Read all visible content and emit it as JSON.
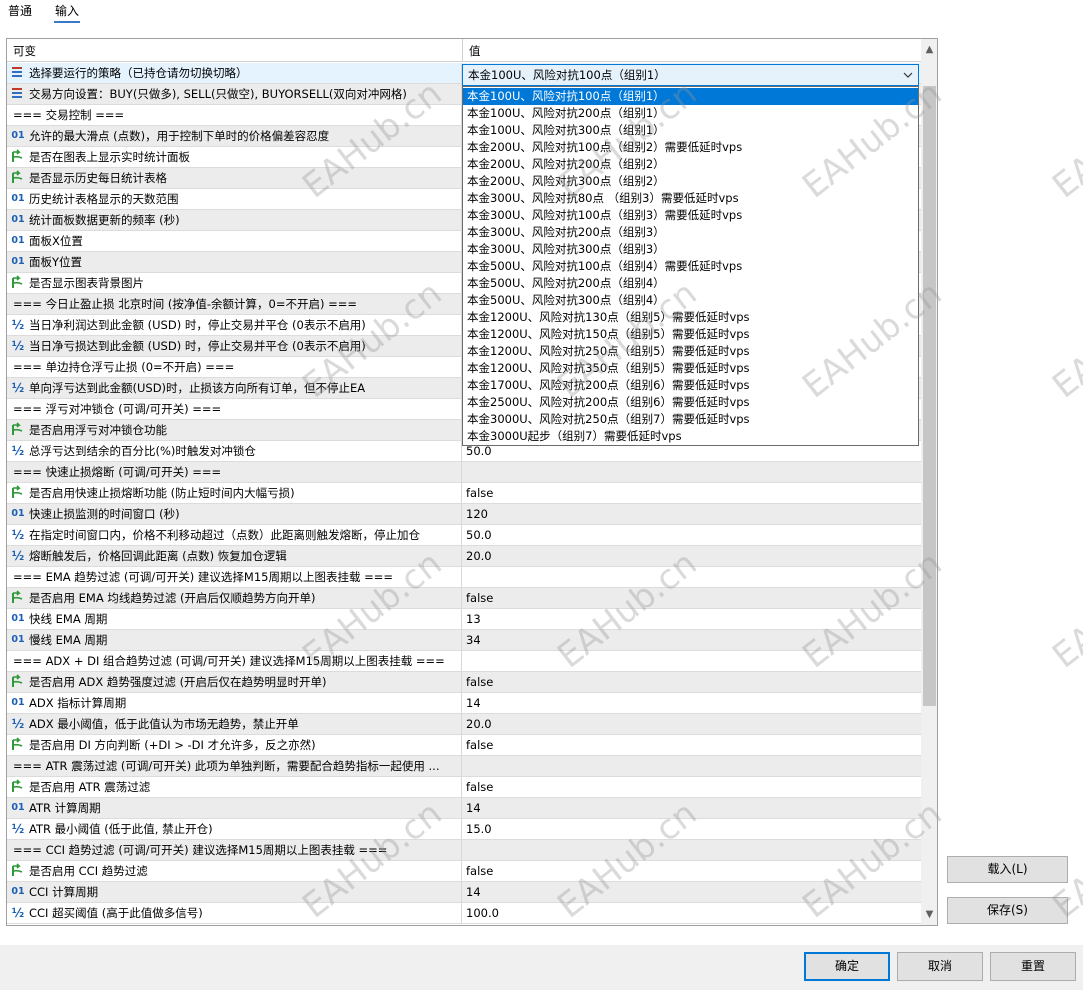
{
  "tabs": [
    "普通",
    "输入"
  ],
  "table": {
    "col_name": "可变",
    "col_value": "值"
  },
  "rows": [
    {
      "icon": "enum",
      "name": "选择要运行的策略（已持仓请勿切换切略）",
      "value": "本金100U、风险对抗100点（组别1）"
    },
    {
      "icon": "enum",
      "name": "交易方向设置：BUY(只做多), SELL(只做空), BUYORSELL(双向对冲网格)",
      "value": ""
    },
    {
      "icon": "",
      "name": "=== 交易控制 ===",
      "value": ""
    },
    {
      "icon": "int",
      "name": "允许的最大滑点 (点数)，用于控制下单时的价格偏差容忍度",
      "value": ""
    },
    {
      "icon": "bool",
      "name": "是否在图表上显示实时统计面板",
      "value": ""
    },
    {
      "icon": "bool",
      "name": "是否显示历史每日统计表格",
      "value": ""
    },
    {
      "icon": "int",
      "name": "历史统计表格显示的天数范围",
      "value": ""
    },
    {
      "icon": "int",
      "name": "统计面板数据更新的频率 (秒)",
      "value": ""
    },
    {
      "icon": "int",
      "name": "面板X位置",
      "value": ""
    },
    {
      "icon": "int",
      "name": "面板Y位置",
      "value": ""
    },
    {
      "icon": "bool",
      "name": "是否显示图表背景图片",
      "value": ""
    },
    {
      "icon": "",
      "name": "=== 今日止盈止损 北京时间 (按净值-余额计算，0=不开启) ===",
      "value": ""
    },
    {
      "icon": "dbl",
      "name": "当日净利润达到此金额 (USD) 时，停止交易并平仓 (0表示不启用)",
      "value": ""
    },
    {
      "icon": "dbl",
      "name": "当日净亏损达到此金额 (USD) 时，停止交易并平仓 (0表示不启用)",
      "value": ""
    },
    {
      "icon": "",
      "name": "=== 单边持仓浮亏止损 (0=不开启) ===",
      "value": ""
    },
    {
      "icon": "dbl",
      "name": "单向浮亏达到此金额(USD)时，止损该方向所有订单，但不停止EA",
      "value": ""
    },
    {
      "icon": "",
      "name": "=== 浮亏对冲锁仓 (可调/可开关)  ===",
      "value": ""
    },
    {
      "icon": "bool",
      "name": "是否启用浮亏对冲锁仓功能",
      "value": ""
    },
    {
      "icon": "dbl",
      "name": "总浮亏达到结余的百分比(%)时触发对冲锁仓",
      "value": "50.0"
    },
    {
      "icon": "",
      "name": "=== 快速止损熔断 (可调/可开关)  ===",
      "value": ""
    },
    {
      "icon": "bool",
      "name": "是否启用快速止损熔断功能 (防止短时间内大幅亏损)",
      "value": "false"
    },
    {
      "icon": "int",
      "name": "快速止损监测的时间窗口 (秒)",
      "value": "120"
    },
    {
      "icon": "dbl",
      "name": "在指定时间窗口内，价格不利移动超过（点数）此距离则触发熔断，停止加仓",
      "value": "50.0"
    },
    {
      "icon": "dbl",
      "name": "熔断触发后，价格回调此距离 (点数) 恢复加仓逻辑",
      "value": "20.0"
    },
    {
      "icon": "",
      "name": "=== EMA 趋势过滤 (可调/可开关) 建议选择M15周期以上图表挂载 ===",
      "value": ""
    },
    {
      "icon": "bool",
      "name": "是否启用 EMA 均线趋势过滤 (开启后仅顺趋势方向开单)",
      "value": "false"
    },
    {
      "icon": "int",
      "name": "快线 EMA 周期",
      "value": "13"
    },
    {
      "icon": "int",
      "name": "慢线 EMA 周期",
      "value": "34"
    },
    {
      "icon": "",
      "name": "=== ADX + DI 组合趋势过滤 (可调/可开关) 建议选择M15周期以上图表挂载 ===",
      "value": ""
    },
    {
      "icon": "bool",
      "name": "是否启用 ADX 趋势强度过滤 (开启后仅在趋势明显时开单)",
      "value": "false"
    },
    {
      "icon": "int",
      "name": "ADX 指标计算周期",
      "value": "14"
    },
    {
      "icon": "dbl",
      "name": "ADX 最小阈值，低于此值认为市场无趋势，禁止开单",
      "value": "20.0"
    },
    {
      "icon": "bool",
      "name": "是否启用 DI 方向判断 (+DI > -DI 才允许多，反之亦然)",
      "value": "false"
    },
    {
      "icon": "",
      "name": "=== ATR 震荡过滤 (可调/可开关) 此项为单独判断，需要配合趋势指标一起使用 ...",
      "value": ""
    },
    {
      "icon": "bool",
      "name": "是否启用 ATR 震荡过滤",
      "value": "false"
    },
    {
      "icon": "int",
      "name": "ATR 计算周期",
      "value": "14"
    },
    {
      "icon": "dbl",
      "name": "ATR 最小阈值 (低于此值, 禁止开仓)",
      "value": "15.0"
    },
    {
      "icon": "",
      "name": "=== CCI 趋势过滤 (可调/可开关) 建议选择M15周期以上图表挂载 ===",
      "value": ""
    },
    {
      "icon": "bool",
      "name": "是否启用 CCI 趋势过滤",
      "value": "false"
    },
    {
      "icon": "int",
      "name": "CCI 计算周期",
      "value": "14"
    },
    {
      "icon": "dbl",
      "name": "CCI 超买阈值 (高于此值做多信号)",
      "value": "100.0"
    }
  ],
  "icon_glyphs": {
    "int": "01",
    "dbl": "½"
  },
  "dropdown": {
    "selected_index": 0,
    "options": [
      "本金100U、风险对抗100点（组别1）",
      "本金100U、风险对抗200点（组别1）",
      "本金100U、风险对抗300点（组别1）",
      "本金200U、风险对抗100点（组别2）需要低延时vps",
      "本金200U、风险对抗200点（组别2）",
      "本金200U、风险对抗300点（组别2）",
      "本金300U、风险对抗80点 （组别3）需要低延时vps",
      "本金300U、风险对抗100点（组别3）需要低延时vps",
      "本金300U、风险对抗200点（组别3）",
      "本金300U、风险对抗300点（组别3）",
      "本金500U、风险对抗100点（组别4）需要低延时vps",
      "本金500U、风险对抗200点（组别4）",
      "本金500U、风险对抗300点（组别4）",
      "本金1200U、风险对抗130点（组别5）需要低延时vps",
      "本金1200U、风险对抗150点（组别5）需要低延时vps",
      "本金1200U、风险对抗250点（组别5）需要低延时vps",
      "本金1200U、风险对抗350点（组别5）需要低延时vps",
      "本金1700U、风险对抗200点（组别6）需要低延时vps",
      "本金2500U、风险对抗200点（组别6）需要低延时vps",
      "本金3000U、风险对抗250点（组别7）需要低延时vps",
      "本金3000U起步（组别7）需要低延时vps"
    ]
  },
  "side_buttons": {
    "load": "载入(L)",
    "save": "保存(S)"
  },
  "footer_buttons": {
    "ok": "确定",
    "cancel": "取消",
    "reset": "重置"
  },
  "watermark": "EAHub.cn",
  "colors": {
    "accent": "#0078d7",
    "bool_icon": "#2e9a3a",
    "enum_icon_red": "#c0392b",
    "enum_icon_blue": "#2f6fc1"
  }
}
